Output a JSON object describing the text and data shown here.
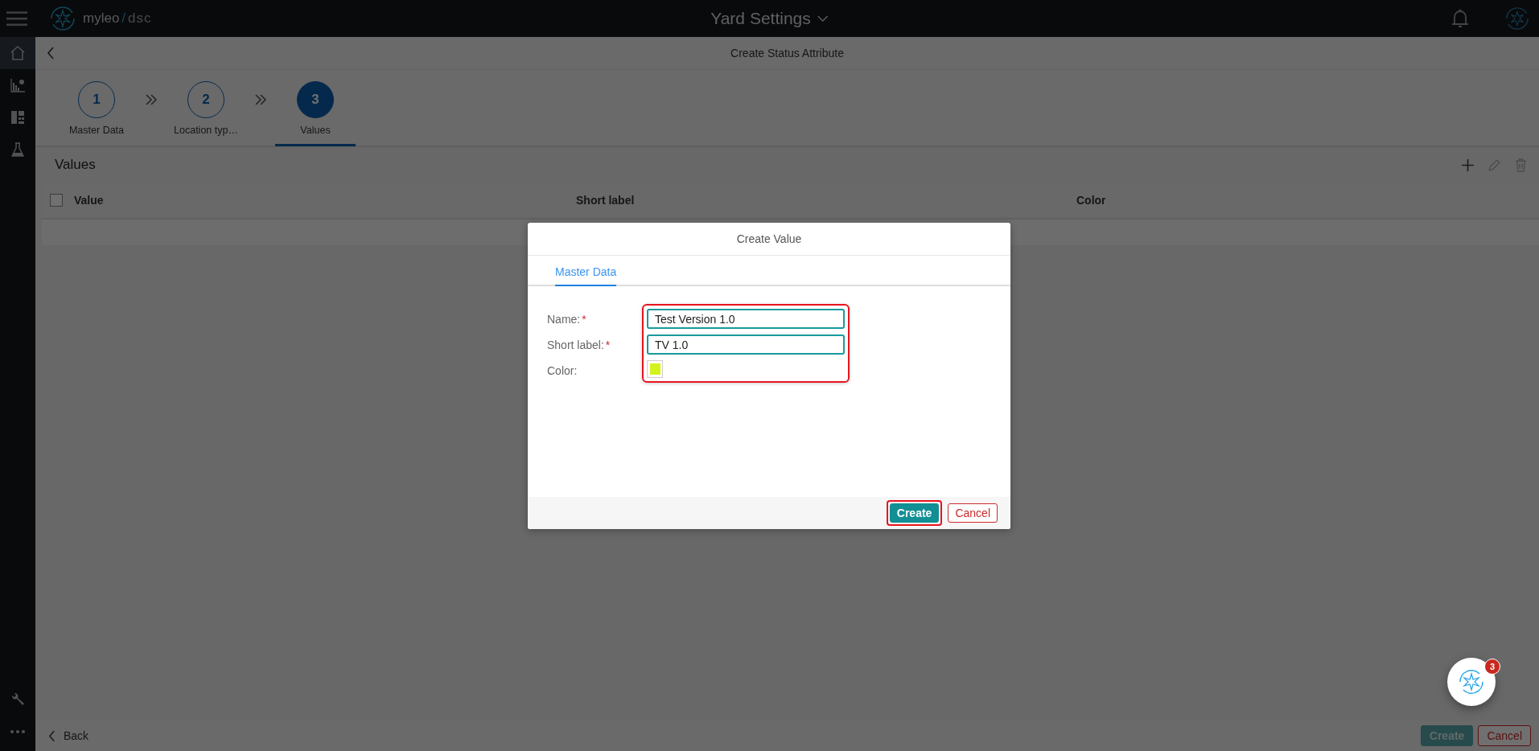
{
  "app_bar": {
    "brand": "myleo",
    "separator": "/",
    "product": "dsc",
    "title": "Yard Settings"
  },
  "sidebar": {
    "items": [
      {
        "kind": "home",
        "selected": true
      },
      {
        "kind": "chart",
        "selected": false
      },
      {
        "kind": "dashboard",
        "selected": false
      },
      {
        "kind": "flask",
        "selected": false
      }
    ],
    "bottom_items": [
      {
        "kind": "wrench",
        "selected": false
      },
      {
        "kind": "more",
        "selected": false
      }
    ]
  },
  "page": {
    "title": "Create Status Attribute"
  },
  "steps": [
    {
      "number": "1",
      "label": "Master Data",
      "selected": false
    },
    {
      "number": "2",
      "label": "Location typ…",
      "selected": false
    },
    {
      "number": "3",
      "label": "Values",
      "selected": true
    }
  ],
  "section": {
    "title": "Values"
  },
  "table": {
    "select_all_checked": false,
    "columns": [
      "Value",
      "Short label",
      "Color"
    ]
  },
  "footer": {
    "back": "Back",
    "buttons": [
      {
        "label": "Create",
        "kind": "primary",
        "disabled": true
      },
      {
        "label": "Cancel",
        "kind": "danger",
        "disabled": false
      }
    ]
  },
  "chat": {
    "badge": "3"
  },
  "dialog": {
    "title": "Create Value",
    "tabs": [
      {
        "label": "Master Data",
        "selected": true
      }
    ],
    "fields_highlighted": true,
    "fields": [
      {
        "kind": "text",
        "label": "Name:",
        "required_mark": "*",
        "value": "Test Version 1.0"
      },
      {
        "kind": "text",
        "label": "Short label:",
        "required_mark": "*",
        "value": "TV 1.0"
      },
      {
        "kind": "color",
        "label": "Color:",
        "color": "#d6f21e"
      }
    ],
    "buttons": [
      {
        "label": "Create",
        "kind": "primary",
        "highlighted": true
      },
      {
        "label": "Cancel",
        "kind": "danger",
        "highlighted": false
      }
    ]
  }
}
